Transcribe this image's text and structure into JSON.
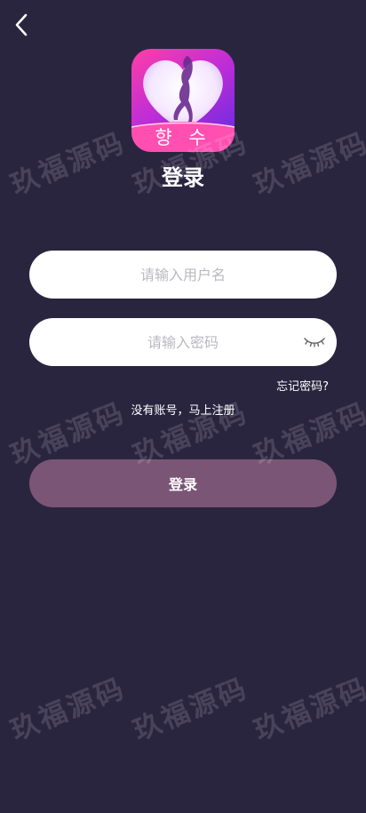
{
  "logo": {
    "text": "향 수",
    "gradient_colors": [
      "#ff3fa6",
      "#c02dd6",
      "#5b2be3"
    ]
  },
  "page": {
    "title": "登录",
    "background": "#2a253f"
  },
  "form": {
    "username_placeholder": "请输入用户名",
    "password_placeholder": "请输入密码",
    "forgot_password": "忘记密码?",
    "register_prompt": "没有账号，马上注册",
    "submit_label": "登录"
  },
  "icons": {
    "back": "chevron-left-icon",
    "password_visibility": "closed-eye-icon"
  },
  "watermark": {
    "text": "玖福源码"
  },
  "colors": {
    "button": "#7a5576",
    "input_bg": "#ffffff",
    "placeholder": "#b9b9c0"
  }
}
